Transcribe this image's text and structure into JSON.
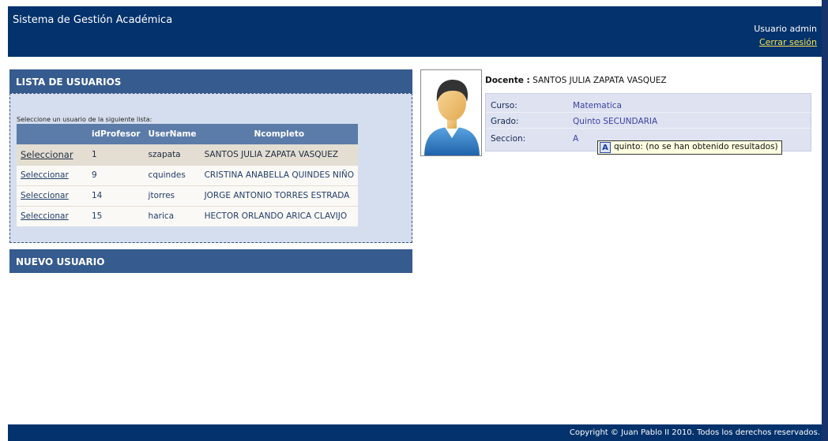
{
  "header": {
    "title": "Sistema de Gestión Académica",
    "user_text": "Usuario admin",
    "logout": "Cerrar sesión"
  },
  "users_panel": {
    "title": "LISTA DE USUARIOS",
    "hint": "Seleccione un usuario de la siguiente lista:",
    "columns": [
      "",
      "idProfesor",
      "UserName",
      "Ncompleto"
    ],
    "rows": [
      {
        "action": "Seleccionar",
        "id": "1",
        "username": "szapata",
        "name": "SANTOS JULIA ZAPATA VASQUEZ",
        "selected": true
      },
      {
        "action": "Seleccionar",
        "id": "9",
        "username": "cquindes",
        "name": "CRISTINA ANABELLA QUINDES NIÑO",
        "selected": false
      },
      {
        "action": "Seleccionar",
        "id": "14",
        "username": "jtorres",
        "name": "JORGE ANTONIO TORRES ESTRADA",
        "selected": false
      },
      {
        "action": "Seleccionar",
        "id": "15",
        "username": "harica",
        "name": "HECTOR ORLANDO ARICA CLAVIJO",
        "selected": false
      }
    ]
  },
  "new_user_panel": {
    "title": "NUEVO USUARIO"
  },
  "teacher": {
    "docente_label": "Docente :",
    "docente_name": "SANTOS JULIA ZAPATA VASQUEZ",
    "fields": [
      {
        "label": "Curso:",
        "value": "Matematica"
      },
      {
        "label": "Grado:",
        "value": "Quinto SECUNDARIA"
      },
      {
        "label": "Seccion:",
        "value": "A"
      }
    ]
  },
  "tooltip": {
    "text": "quinto: (no se han obtenido resultados)",
    "icon": "dictionary-icon"
  },
  "footer": {
    "copyright": "Copyright © Juan Pablo II 2010. Todos los derechos reservados."
  },
  "colors": {
    "header": "#04326c",
    "panel_header": "#365b8f",
    "panel_bg": "#d5deee",
    "link_yellow": "#f4e04d"
  }
}
